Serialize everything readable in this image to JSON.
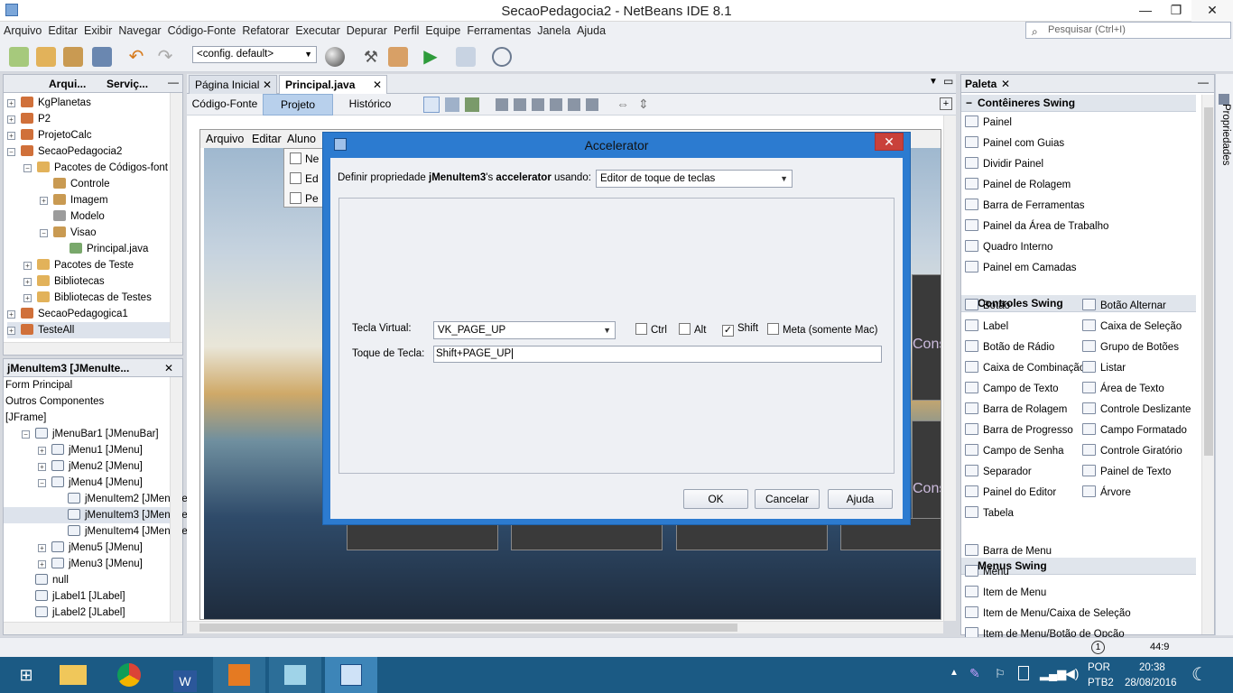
{
  "window": {
    "title": "SecaoPedagocia2 - NetBeans IDE 8.1",
    "min": "—",
    "max": "❐",
    "close": "✕"
  },
  "menu": [
    "Arquivo",
    "Editar",
    "Exibir",
    "Navegar",
    "Código-Fonte",
    "Refatorar",
    "Executar",
    "Depurar",
    "Perfil",
    "Equipe",
    "Ferramentas",
    "Janela",
    "Ajuda"
  ],
  "search": {
    "placeholder": "Pesquisar (Ctrl+I)"
  },
  "toolbar": {
    "config": "<config. default>"
  },
  "projects": {
    "tabs": [
      "Arqui...",
      "Serviç..."
    ],
    "items": [
      {
        "label": "KgPlanetas",
        "indent": 0,
        "exp": "+",
        "color": "#d0703a"
      },
      {
        "label": "P2",
        "indent": 0,
        "exp": "+",
        "color": "#d0703a"
      },
      {
        "label": "ProjetoCalc",
        "indent": 0,
        "exp": "+",
        "color": "#d0703a"
      },
      {
        "label": "SecaoPedagocia2",
        "indent": 0,
        "exp": "−",
        "color": "#d0703a"
      },
      {
        "label": "Pacotes de Códigos-font",
        "indent": 1,
        "exp": "−",
        "color": "#e2b25a"
      },
      {
        "label": "Controle",
        "indent": 2,
        "exp": "",
        "color": "#c99a52"
      },
      {
        "label": "Imagem",
        "indent": 2,
        "exp": "+",
        "color": "#c99a52"
      },
      {
        "label": "Modelo",
        "indent": 2,
        "exp": "",
        "color": "#9c9c9c"
      },
      {
        "label": "Visao",
        "indent": 2,
        "exp": "−",
        "color": "#c99a52"
      },
      {
        "label": "Principal.java",
        "indent": 3,
        "exp": "",
        "color": "#79a86b"
      },
      {
        "label": "Pacotes de Teste",
        "indent": 1,
        "exp": "+",
        "color": "#e2b25a"
      },
      {
        "label": "Bibliotecas",
        "indent": 1,
        "exp": "+",
        "color": "#e2b25a"
      },
      {
        "label": "Bibliotecas de Testes",
        "indent": 1,
        "exp": "+",
        "color": "#e2b25a"
      },
      {
        "label": "SecaoPedagogica1",
        "indent": 0,
        "exp": "+",
        "color": "#d0703a"
      },
      {
        "label": "TesteAll",
        "indent": 0,
        "exp": "+",
        "color": "#d0703a"
      }
    ]
  },
  "navigator": {
    "title": "jMenuItem3 [JMenuIte...",
    "items": [
      {
        "label": "Form Principal",
        "indent": 0,
        "exp": ""
      },
      {
        "label": "Outros Componentes",
        "indent": 0,
        "exp": ""
      },
      {
        "label": "[JFrame]",
        "indent": 0,
        "exp": ""
      },
      {
        "label": "jMenuBar1 [JMenuBar]",
        "indent": 1,
        "exp": "−"
      },
      {
        "label": "jMenu1 [JMenu]",
        "indent": 2,
        "exp": "+"
      },
      {
        "label": "jMenu2 [JMenu]",
        "indent": 2,
        "exp": "+"
      },
      {
        "label": "jMenu4 [JMenu]",
        "indent": 2,
        "exp": "−"
      },
      {
        "label": "jMenuItem2 [JMenuIte",
        "indent": 3,
        "exp": ""
      },
      {
        "label": "jMenuItem3 [JMenuIte",
        "indent": 3,
        "exp": ""
      },
      {
        "label": "jMenuItem4 [JMenuIte",
        "indent": 3,
        "exp": ""
      },
      {
        "label": "jMenu5 [JMenu]",
        "indent": 2,
        "exp": "+"
      },
      {
        "label": "jMenu3 [JMenu]",
        "indent": 2,
        "exp": "+"
      },
      {
        "label": "null",
        "indent": 1,
        "exp": ""
      },
      {
        "label": "jLabel1 [JLabel]",
        "indent": 1,
        "exp": ""
      },
      {
        "label": "jLabel2 [JLabel]",
        "indent": 1,
        "exp": ""
      }
    ]
  },
  "editor": {
    "tabs": [
      "Página Inicial",
      "Principal.java"
    ],
    "views": [
      "Código-Fonte",
      "Projeto",
      "Histórico"
    ]
  },
  "form": {
    "menu": [
      "Arquivo",
      "Editar",
      "Aluno"
    ],
    "popup": [
      "Ne",
      "Ed",
      "Pe"
    ],
    "bgtext": [
      "Cons",
      "Cons"
    ]
  },
  "dialog": {
    "title": "Accelerator",
    "prompt_pre": "Definir propriedade ",
    "prop": "jMenuItem3",
    "prompt_mid": "'s ",
    "prop2": "accelerator",
    "prompt_post": " usando:",
    "editor": "Editor de toque de teclas",
    "vk_label": "Tecla Virtual:",
    "vk_value": "VK_PAGE_UP",
    "mods": [
      {
        "label": "Ctrl",
        "checked": false
      },
      {
        "label": "Alt",
        "checked": false
      },
      {
        "label": "Shift",
        "checked": true
      },
      {
        "label": "Meta (somente Mac)",
        "checked": false
      }
    ],
    "key_label": "Toque de Tecla:",
    "key_value": "Shift+PAGE_UP",
    "ok": "OK",
    "cancel": "Cancelar",
    "help": "Ajuda"
  },
  "palette": {
    "title": "Paleta",
    "side": "Propriedades",
    "cats": [
      {
        "name": "Contêineres Swing",
        "items": [
          "Painel",
          "Painel com Guias",
          "Dividir Painel",
          "Painel de Rolagem",
          "Barra de Ferramentas",
          "Painel da Área de Trabalho",
          "Quadro Interno",
          "Painel em Camadas"
        ],
        "cols": 1
      },
      {
        "name": "Controles Swing",
        "items": [
          "Botão",
          "Botão Alternar",
          "Label",
          "Caixa de Seleção",
          "Botão de Rádio",
          "Grupo de Botões",
          "Caixa de Combinação",
          "Listar",
          "Campo de Texto",
          "Área de Texto",
          "Barra de Rolagem",
          "Controle Deslizante",
          "Barra de Progresso",
          "Campo Formatado",
          "Campo de Senha",
          "Controle Giratório",
          "Separador",
          "Painel de Texto",
          "Painel do Editor",
          "Árvore",
          "Tabela"
        ],
        "cols": 2
      },
      {
        "name": "Menus Swing",
        "items": [
          "Barra de Menu",
          "Menu",
          "Item de Menu",
          "Item de Menu/Caixa de Seleção",
          "Item de Menu/Botão de Opção"
        ],
        "cols": 1
      }
    ]
  },
  "status": {
    "badge": "1",
    "position": "44:9"
  },
  "tray": {
    "lang": "POR",
    "layout": "PTB2",
    "time": "20:38",
    "date": "28/08/2016"
  }
}
